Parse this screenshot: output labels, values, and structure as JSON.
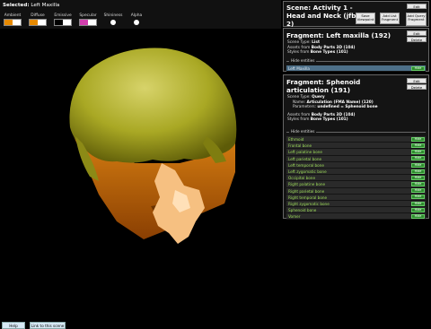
{
  "selection": {
    "label": "Selected:",
    "value": "Left Maxilla"
  },
  "materials": [
    {
      "label": "Ambient",
      "colors": [
        "#e78a00",
        "#ffffff"
      ]
    },
    {
      "label": "Diffuse",
      "colors": [
        "#e78a00",
        "#ffffff"
      ]
    },
    {
      "label": "Emissive",
      "colors": [
        "#000000",
        "#ffffff"
      ]
    },
    {
      "label": "Specular",
      "colors": [
        "#d23fae",
        "#ffffff"
      ]
    },
    {
      "label": "Shininess",
      "colors": []
    },
    {
      "label": "Alpha",
      "colors": []
    }
  ],
  "scene": {
    "title": "Scene: Activity 1 - Head and Neck (jfb 2)",
    "edit": "Edit",
    "save_viewpoint": "Save Viewpoint",
    "add_list_fragment": "Add List Fragment",
    "add_query_fragment": "Add Query Fragment"
  },
  "fragment1": {
    "title": "Fragment: Left maxilla (192)",
    "edit": "Edit",
    "delete": "Delete",
    "type_label": "Scene Type:",
    "type_value": "List",
    "assets_label": "Assets from",
    "assets_value": "Body Parts 3D (104)",
    "styles_label": "Styles from",
    "styles_value": "Bone Types (101)",
    "hide_entities": "Hide entities",
    "entities": [
      {
        "name": "Left Maxilla",
        "action": "Hide"
      }
    ]
  },
  "fragment2": {
    "title": "Fragment: Sphenoid articulation (191)",
    "edit": "Edit",
    "delete": "Delete",
    "type_label": "Scene Type:",
    "type_value": "Query",
    "name_label": "Name:",
    "name_value": "Articulation (FMA Name) (120)",
    "params_label": "Parameters:",
    "params_value": "undefined = Sphenoid bone",
    "assets_label": "Assets from",
    "assets_value": "Body Parts 3D (104)",
    "styles_label": "Styles from",
    "styles_value": "Bone Types (101)",
    "hide_entities": "Hide entities",
    "entities": [
      {
        "name": "Ethmoid",
        "action": "Hide"
      },
      {
        "name": "Frontal bone",
        "action": "Hide"
      },
      {
        "name": "Left palatine bone",
        "action": "Hide"
      },
      {
        "name": "Left parietal bone",
        "action": "Hide"
      },
      {
        "name": "Left temporal bone",
        "action": "Hide"
      },
      {
        "name": "Left zygomatic bone",
        "action": "Hide"
      },
      {
        "name": "Occipital bone",
        "action": "Hide"
      },
      {
        "name": "Right palatine bone",
        "action": "Hide"
      },
      {
        "name": "Right parietal bone",
        "action": "Hide"
      },
      {
        "name": "Right temporal bone",
        "action": "Hide"
      },
      {
        "name": "Right zygomatic bone",
        "action": "Hide"
      },
      {
        "name": "Sphenoid bone",
        "action": "Hide"
      },
      {
        "name": "Vomer",
        "action": "Hide"
      }
    ]
  },
  "bottom": {
    "help": "Help",
    "link": "Link to this scene"
  }
}
